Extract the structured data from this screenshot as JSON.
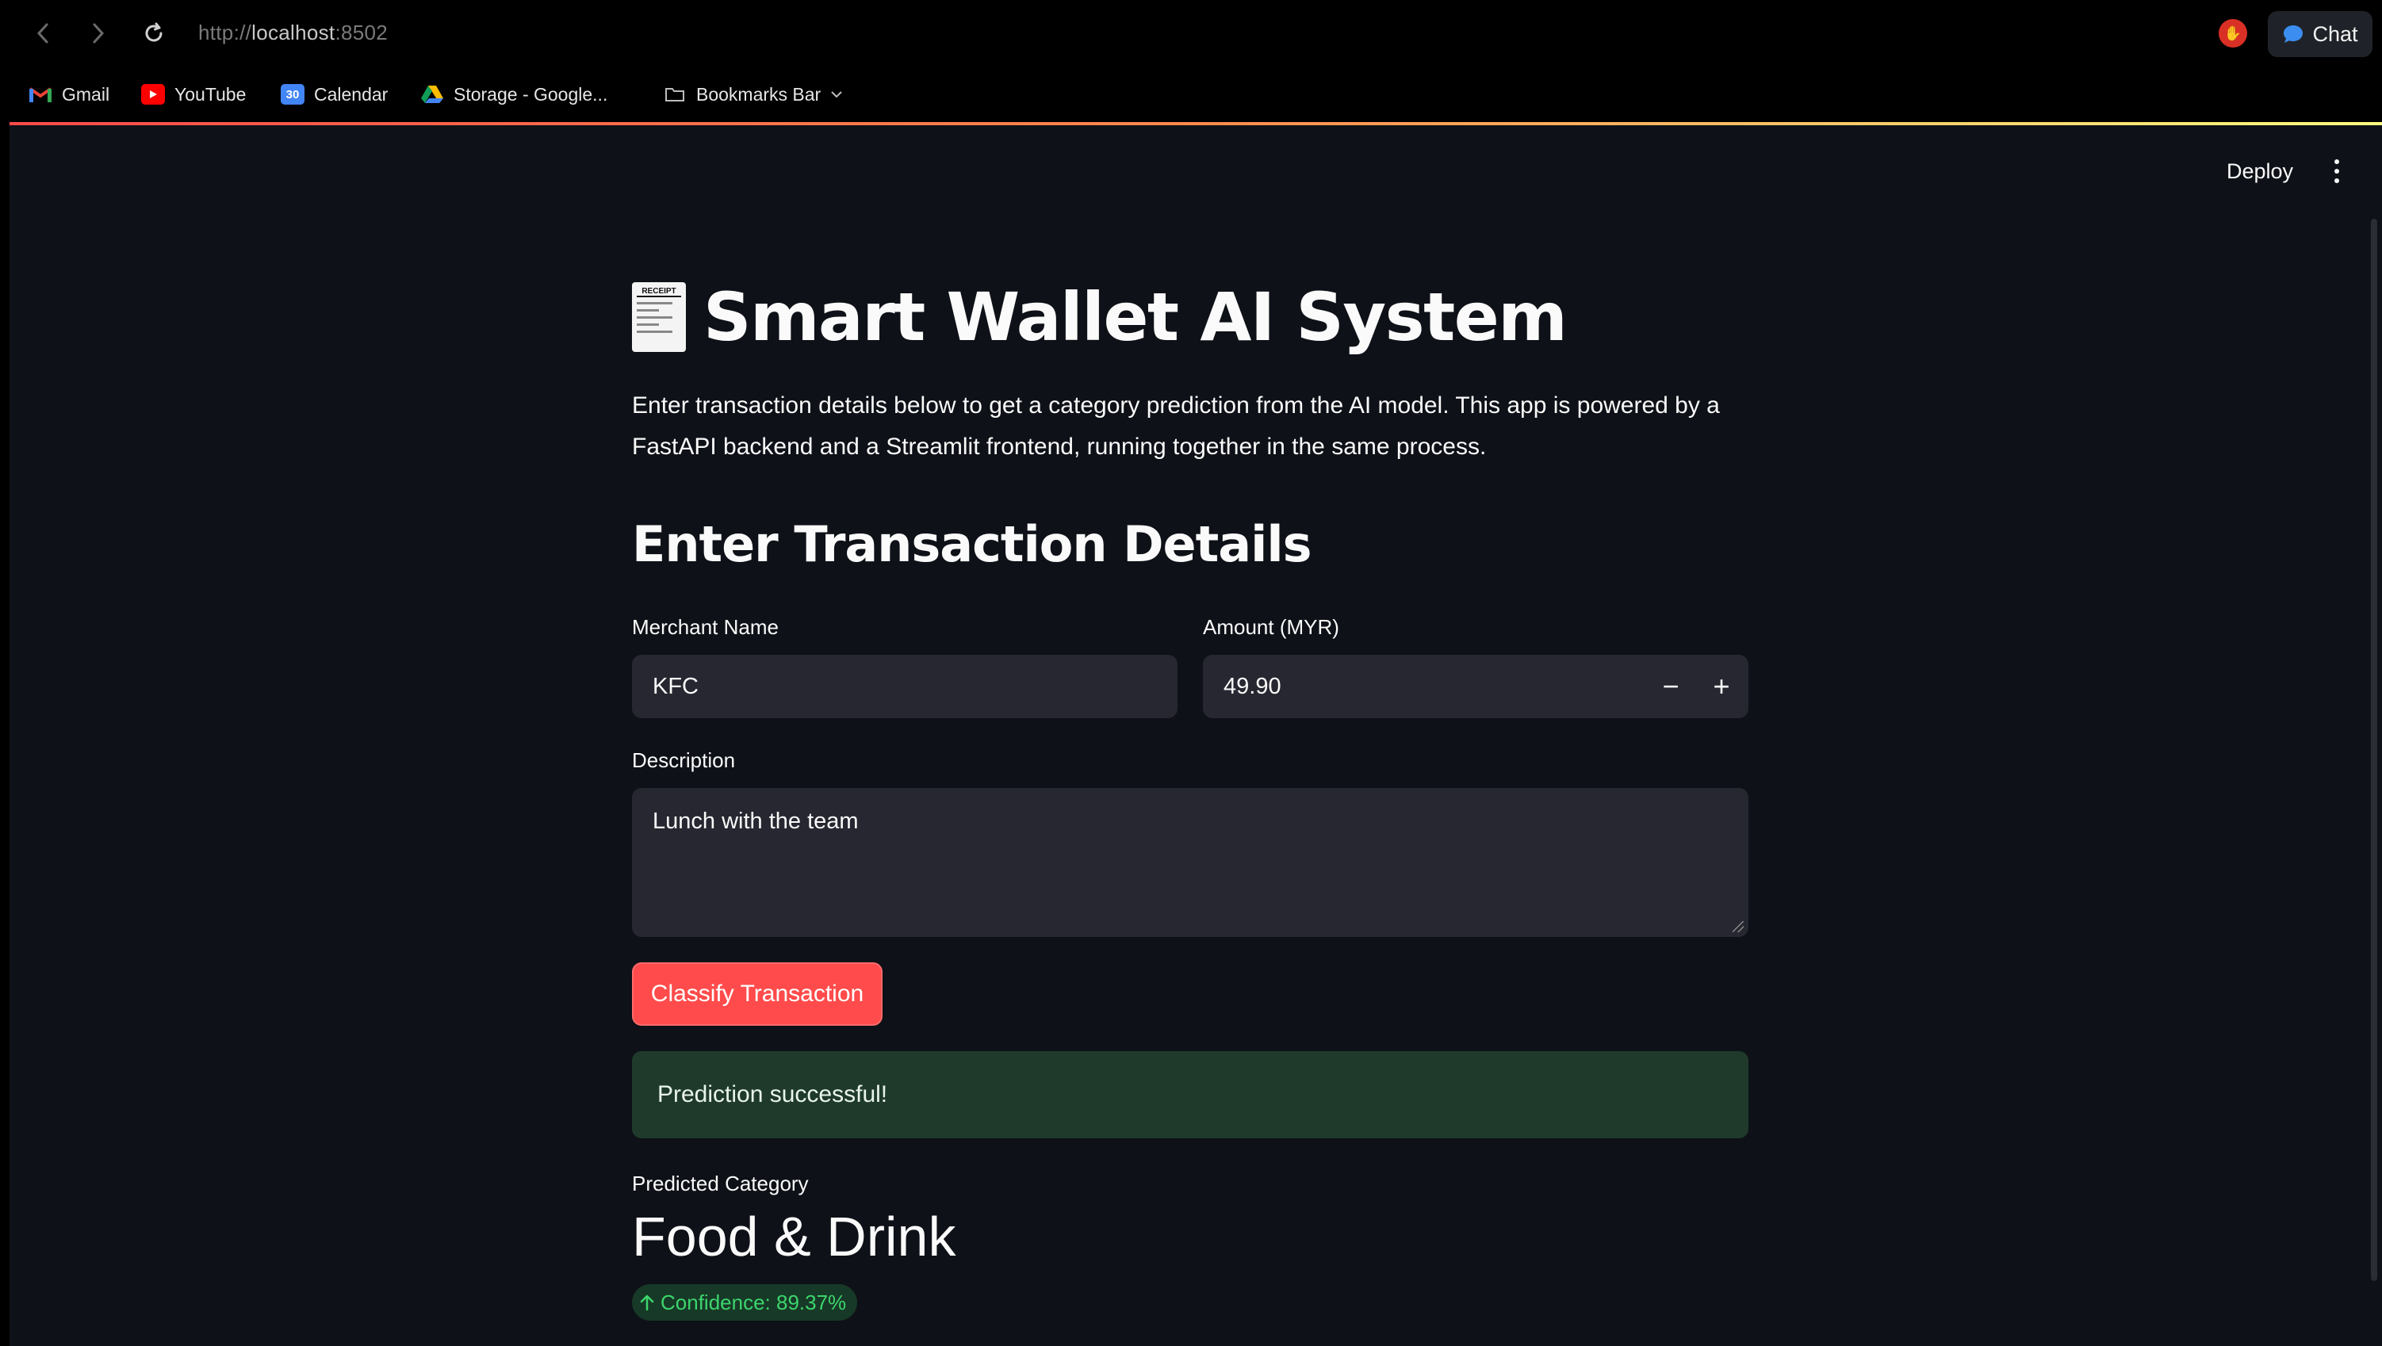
{
  "browser": {
    "url_scheme": "http://",
    "url_host": "localhost",
    "url_port": ":8502",
    "chat_label": "Chat"
  },
  "bookmarks": [
    {
      "label": "Gmail",
      "icon": "gmail-icon"
    },
    {
      "label": "YouTube",
      "icon": "youtube-icon"
    },
    {
      "label": "Calendar",
      "icon": "calendar-icon",
      "icon_text": "30"
    },
    {
      "label": "Storage - Google...",
      "icon": "google-drive-icon"
    },
    {
      "label": "Bookmarks Bar",
      "icon": "folder-icon"
    }
  ],
  "toolbar": {
    "deploy_label": "Deploy"
  },
  "app": {
    "title": "Smart Wallet AI System",
    "title_icon": "receipt-icon",
    "receipt_text": "RECEIPT",
    "intro": "Enter transaction details below to get a category prediction from the AI model. This app is powered by a FastAPI backend and a Streamlit frontend, running together in the same process.",
    "section_heading": "Enter Transaction Details",
    "form": {
      "merchant_label": "Merchant Name",
      "merchant_value": "KFC",
      "amount_label": "Amount (MYR)",
      "amount_value": "49.90",
      "decrement": "−",
      "increment": "+",
      "description_label": "Description",
      "description_value": "Lunch with the team",
      "submit_label": "Classify Transaction"
    },
    "result": {
      "success_message": "Prediction successful!",
      "metric_label": "Predicted Category",
      "metric_value": "Food & Drink",
      "delta_text": "Confidence: 89.37%"
    }
  },
  "colors": {
    "accent": "#ff4b4b",
    "background": "#0e1117",
    "input_bg": "#262730",
    "success_bg": "#1f3a2b",
    "delta_green": "#3dd56d"
  }
}
